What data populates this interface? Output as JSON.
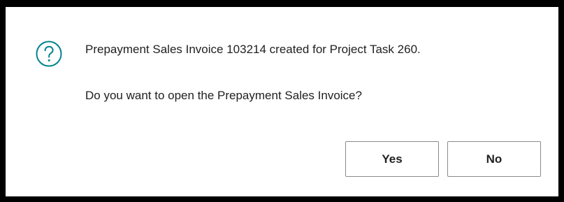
{
  "dialog": {
    "icon": "question-mark-circle-icon",
    "accent_color": "#00838f",
    "message": "Prepayment Sales Invoice 103214 created for Project Task 260.",
    "question": "Do you want to open the Prepayment Sales Invoice?",
    "yes_label": "Yes",
    "no_label": "No"
  }
}
